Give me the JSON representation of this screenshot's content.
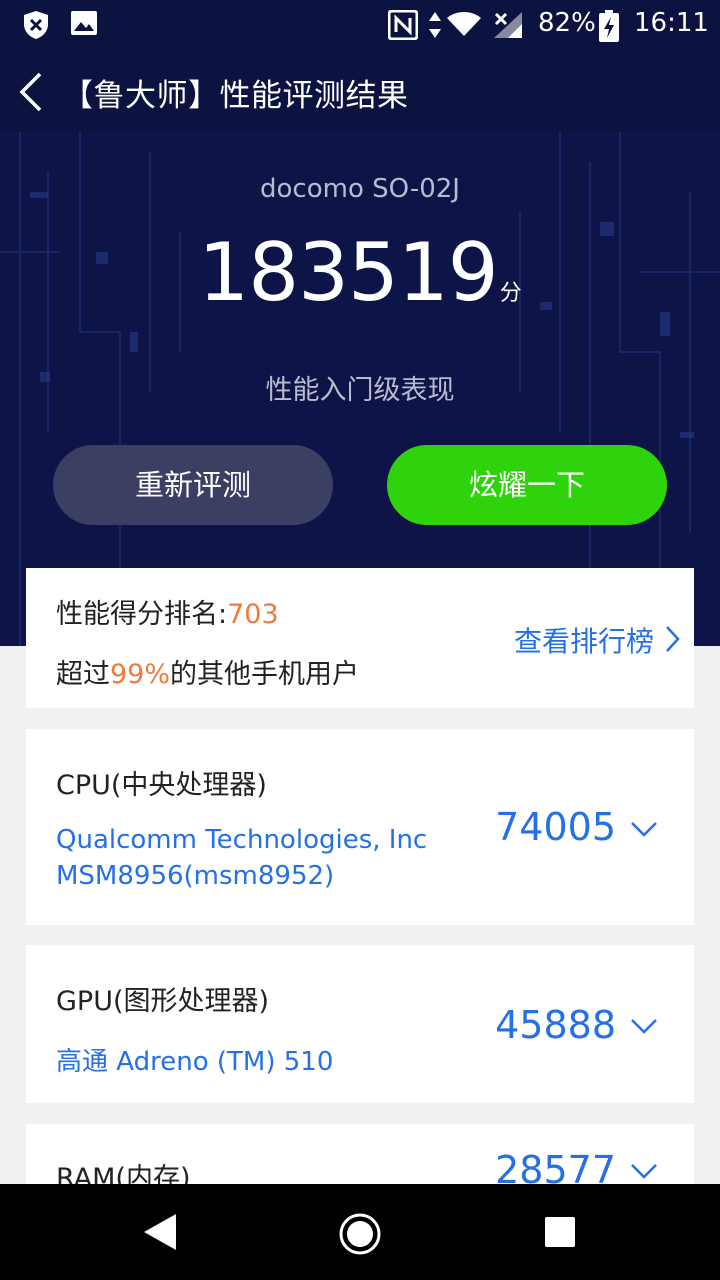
{
  "status_bar": {
    "battery_percent": "82%",
    "time": "16:11"
  },
  "app_bar": {
    "title": "【鲁大师】性能评测结果"
  },
  "result": {
    "device_name": "docomo SO-02J",
    "total_score": "183519",
    "score_unit": "分",
    "level_text": "性能入门级表现"
  },
  "buttons": {
    "retest_label": "重新评测",
    "share_label": "炫耀一下"
  },
  "ranking": {
    "rank_label": "性能得分排名:",
    "rank_value": "703",
    "exceed_prefix": "超过",
    "exceed_percent": "99%",
    "exceed_suffix": "的其他手机用户",
    "view_leaderboard": "查看排行榜"
  },
  "components": {
    "cpu": {
      "title": "CPU(中央处理器)",
      "vendor": "Qualcomm Technologies, Inc",
      "model": "MSM8956(msm8952)",
      "score": "74005"
    },
    "gpu": {
      "title": "GPU(图形处理器)",
      "model": "高通 Adreno (TM) 510",
      "score": "45888"
    },
    "ram": {
      "title": "RAM(内存)",
      "score": "28577"
    }
  },
  "colors": {
    "hero_bg": "#0e1448",
    "accent_blue": "#2470e6",
    "accent_orange": "#f07a3a",
    "share_green": "#2fd30c",
    "retest_gray": "#3b3f62"
  }
}
